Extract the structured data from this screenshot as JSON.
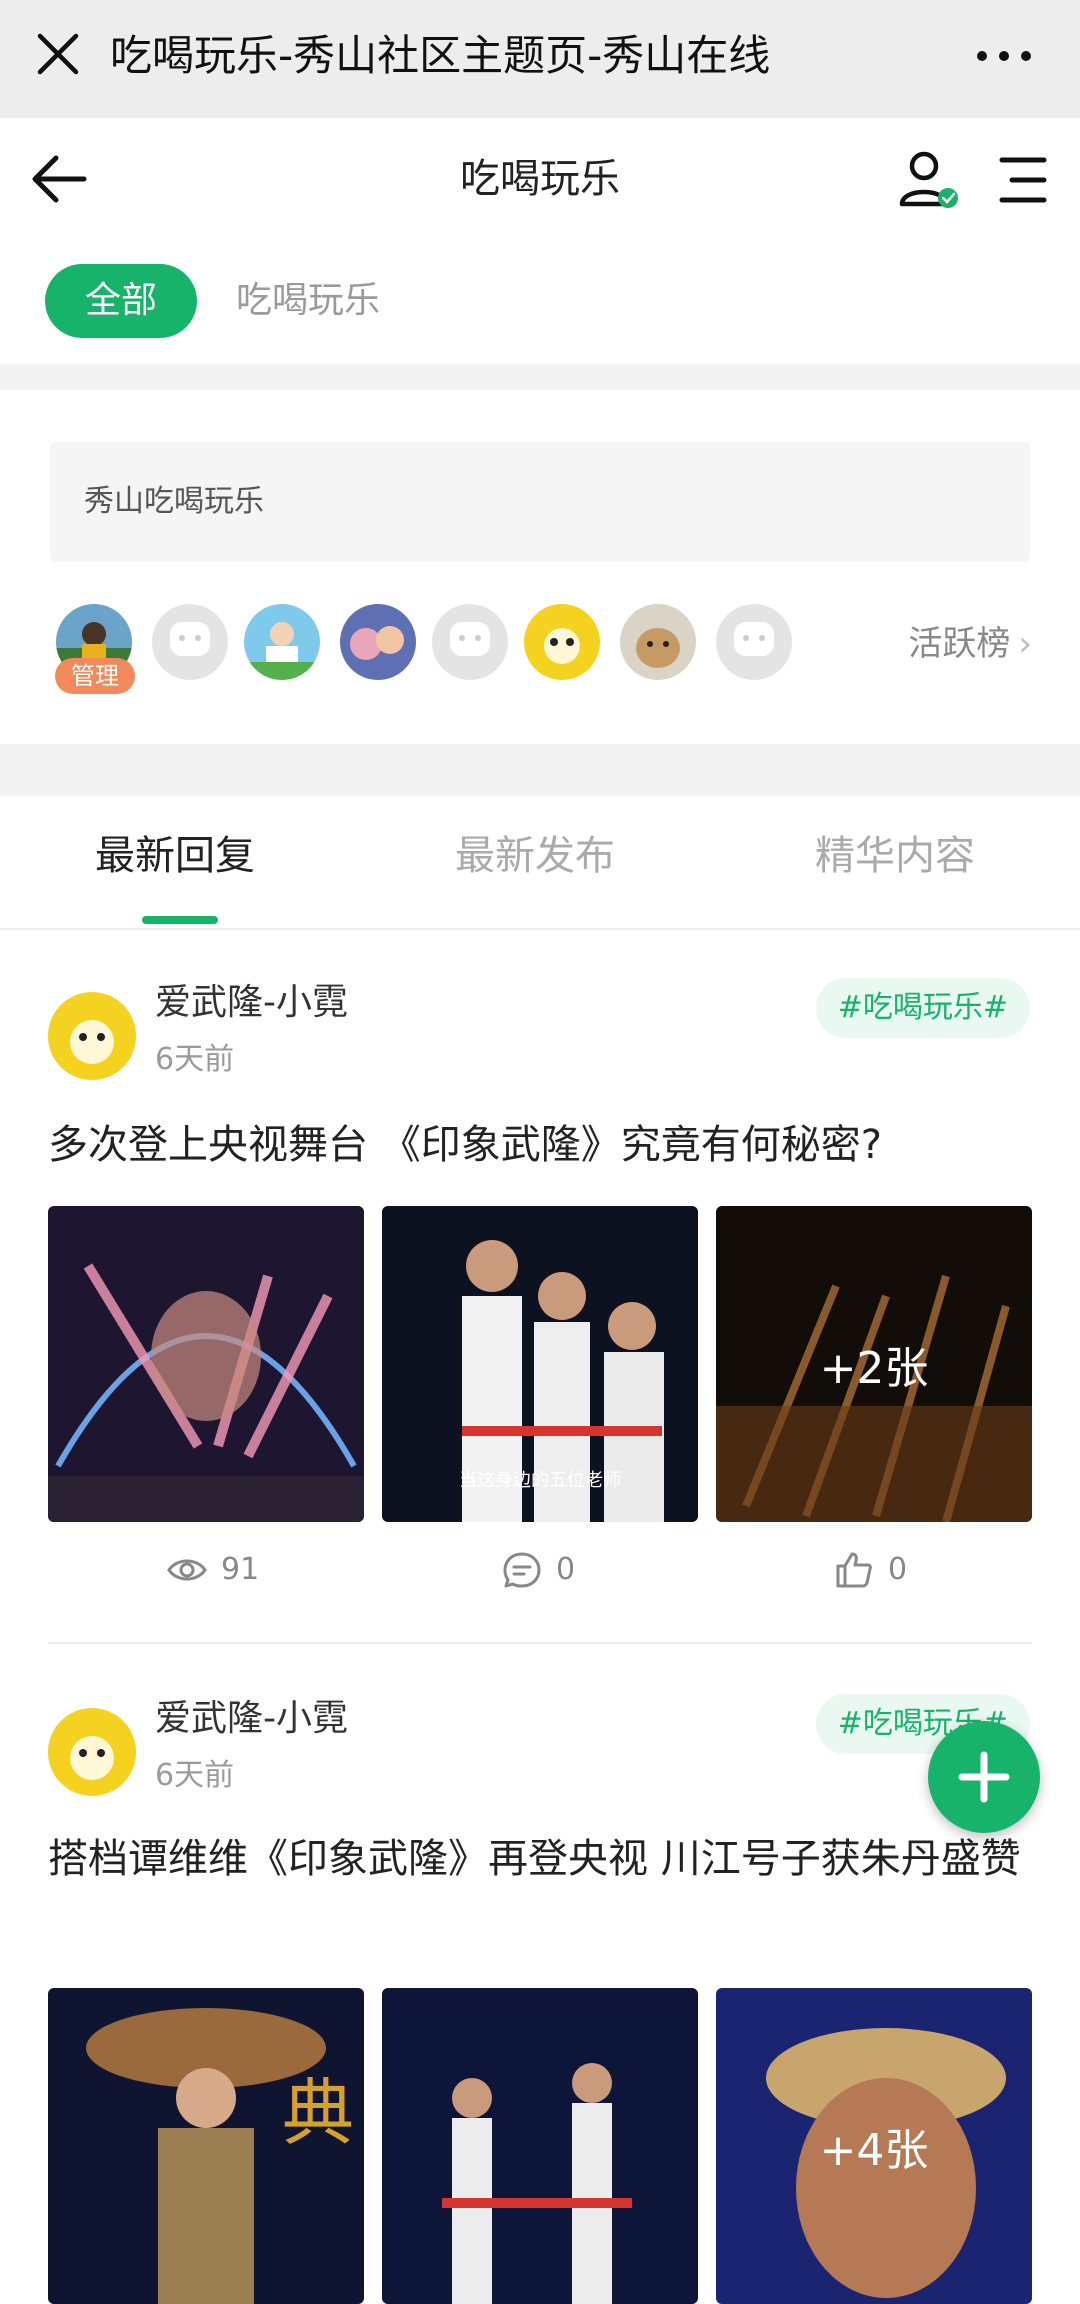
{
  "browser": {
    "title": "吃喝玩乐-秀山社区主题页-秀山在线"
  },
  "header": {
    "title": "吃喝玩乐"
  },
  "chips": {
    "all": "全部",
    "second": "吃喝玩乐"
  },
  "group": {
    "intro": "秀山吃喝玩乐",
    "admin_badge": "管理",
    "rank_label": "活跃榜"
  },
  "tabs": [
    {
      "label": "最新回复"
    },
    {
      "label": "最新发布"
    },
    {
      "label": "精华内容"
    }
  ],
  "posts": [
    {
      "author": "爱武隆-小霓",
      "time": "6天前",
      "tag": "#吃喝玩乐#",
      "title": "多次登上央视舞台 《印象武隆》究竟有何秘密?",
      "image_caption": "当这身边的五位老师",
      "more_images": "+2张",
      "views": "91",
      "comments": "0",
      "likes": "0"
    },
    {
      "author": "爱武隆-小霓",
      "time": "6天前",
      "tag": "#吃喝玩乐#",
      "title": "搭档谭维维《印象武隆》再登央视 川江号子获朱丹盛赞",
      "more_images": "+4张"
    }
  ],
  "colors": {
    "accent": "#17b36a",
    "badge": "#f08a5d",
    "browser_bar": "#ededed"
  }
}
